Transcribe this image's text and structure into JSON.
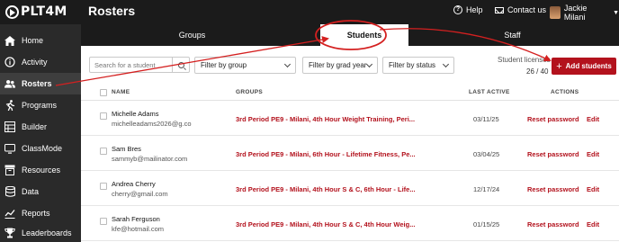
{
  "app": {
    "logo_text": "PLT4M",
    "page_title": "Rosters"
  },
  "header": {
    "help_label": "Help",
    "contact_label": "Contact us",
    "user_name": "Jackie Milani"
  },
  "sidebar": {
    "items": [
      {
        "label": "Home",
        "icon": "home-icon"
      },
      {
        "label": "Activity",
        "icon": "info-icon"
      },
      {
        "label": "Rosters",
        "icon": "users-icon",
        "active": true
      },
      {
        "label": "Programs",
        "icon": "runner-icon"
      },
      {
        "label": "Builder",
        "icon": "grid-icon"
      },
      {
        "label": "ClassMode",
        "icon": "screen-icon"
      },
      {
        "label": "Resources",
        "icon": "box-icon"
      },
      {
        "label": "Data",
        "icon": "database-icon"
      },
      {
        "label": "Reports",
        "icon": "chart-icon"
      },
      {
        "label": "Leaderboards",
        "icon": "trophy-icon"
      }
    ]
  },
  "tabs": [
    {
      "label": "Groups"
    },
    {
      "label": "Students",
      "active": true
    },
    {
      "label": "Staff"
    }
  ],
  "filters": {
    "search_placeholder": "Search for a student",
    "group": "Filter by group",
    "grad_year": "Filter by grad year",
    "status": "Filter by status"
  },
  "licenses": {
    "label": "Student licenses",
    "count": "26 / 40"
  },
  "add_button": {
    "label": "Add students"
  },
  "table": {
    "headers": {
      "name": "NAME",
      "groups": "GROUPS",
      "last_active": "LAST ACTIVE",
      "actions": "ACTIONS"
    },
    "reset_label": "Reset password",
    "edit_label": "Edit",
    "rows": [
      {
        "name": "Michelle Adams",
        "email": "michelleadams2026@g.co",
        "groups": "3rd Period PE9 - Milani, 4th Hour Weight Training, Peri...",
        "last_active": "03/11/25"
      },
      {
        "name": "Sam Bres",
        "email": "sammyb@mailinator.com",
        "groups": "3rd Period PE9 - Milani, 6th Hour - Lifetime Fitness, Pe...",
        "last_active": "03/04/25"
      },
      {
        "name": "Andrea Cherry",
        "email": "cherry@gmail.com",
        "groups": "3rd Period PE9 - Milani, 4th Hour S & C, 6th Hour - Life...",
        "last_active": "12/17/24"
      },
      {
        "name": "Sarah Ferguson",
        "email": "kfe@hotmail.com",
        "groups": "3rd Period PE9 - Milani, 4th Hour S & C, 4th Hour Weig...",
        "last_active": "01/15/25"
      }
    ]
  },
  "colors": {
    "accent": "#b3121d",
    "header_bg": "#1b1b1b",
    "sidebar_bg": "#2a2a2a",
    "annotation": "#d42020"
  }
}
